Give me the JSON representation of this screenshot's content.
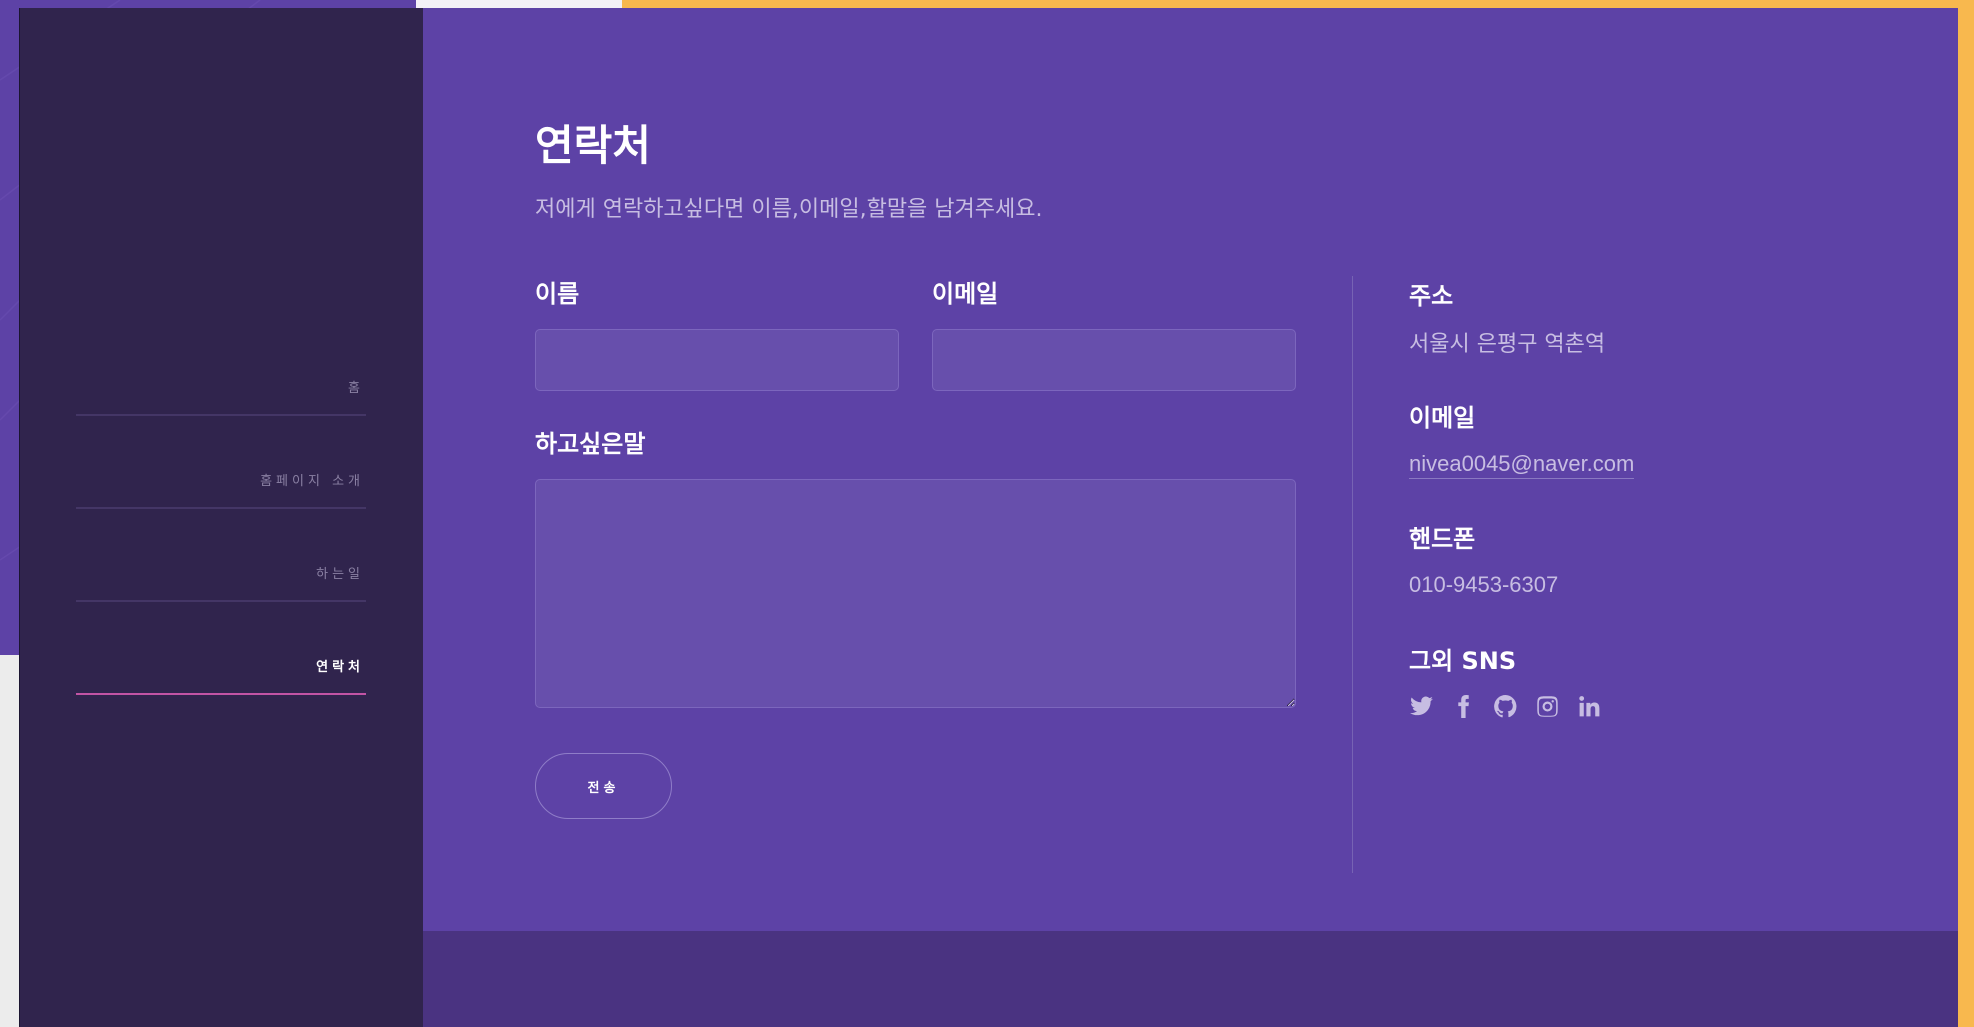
{
  "nav": {
    "items": [
      {
        "label": "홈"
      },
      {
        "label": "홈페이지 소개"
      },
      {
        "label": "하는일"
      },
      {
        "label": "연락처",
        "active": true
      }
    ]
  },
  "contact": {
    "title": "연락처",
    "subtitle": "저에게 연락하고싶다면 이름,이메일,할말을 남겨주세요.",
    "form": {
      "name_label": "이름",
      "name_value": "",
      "email_label": "이메일",
      "email_value": "",
      "message_label": "하고싶은말",
      "message_value": "",
      "submit_label": "전송"
    },
    "info": {
      "address_title": "주소",
      "address_value": "서울시 은평구 역촌역",
      "email_title": "이메일",
      "email_value": "nivea0045@naver.com",
      "phone_title": "핸드폰",
      "phone_value": "010-9453-6307",
      "sns_title": "그외 SNS",
      "sns_icons": [
        "twitter-icon",
        "facebook-icon",
        "github-icon",
        "instagram-icon",
        "linkedin-icon"
      ]
    }
  },
  "colors": {
    "main_bg": "#5d42a6",
    "sidebar_bg": "#30244d",
    "accent_orange": "#f8b84e",
    "active_underline": "#c254a5",
    "footer_bg": "#4a3381",
    "muted_text": "#c7bde2"
  }
}
